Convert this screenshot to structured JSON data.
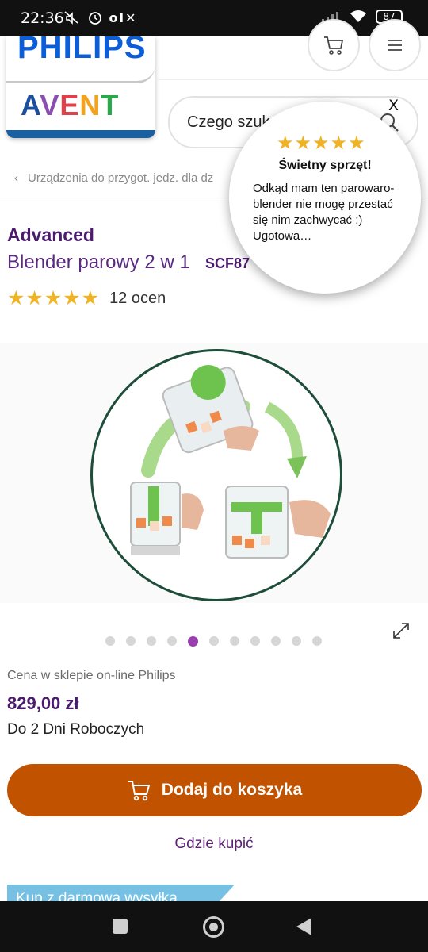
{
  "status_bar": {
    "time": "22:36",
    "icons": "✕⏰",
    "battery": "87"
  },
  "brand": {
    "philips": "PHILIPS",
    "avent": "AVENT",
    "avent_colors": [
      "#1b4f9c",
      "#8a4fb0",
      "#e0404a",
      "#f2a21b",
      "#2aa84a",
      "#1b4f9c"
    ]
  },
  "header": {
    "cart_icon": "cart-icon",
    "menu_icon": "menu-icon",
    "search_placeholder": "Czego szuk"
  },
  "breadcrumb": {
    "label": "Urządzenia do przygot. jedz. dla dz"
  },
  "product": {
    "brand_line": "Advanced",
    "title": "Blender parowy 2 w 1",
    "model": "SCF87",
    "rating_stars": "★★★★★",
    "rating": 5,
    "reviews": "12 ocen"
  },
  "carousel": {
    "dots": 11,
    "active_index": 4
  },
  "pricing": {
    "label": "Cena w sklepie on-line Philips",
    "price": "829,00  zł",
    "delivery": "Do 2 Dni Roboczych"
  },
  "actions": {
    "add_to_cart": "Dodaj do koszyka",
    "where_to_buy": "Gdzie kupić"
  },
  "promo": {
    "text": "Kup z darmową wysyłką"
  },
  "review_popup": {
    "stars": "★★★★★",
    "title": "Świetny sprzęt!",
    "body": "Odkąd mam ten parowaro-blender nie mogę przestać się nim zachwycać ;) Ugotowa…",
    "close": "X"
  },
  "colors": {
    "accent_purple": "#4b1b6e",
    "cart_orange": "#c15300",
    "star_gold": "#f0b323",
    "active_dot": "#9b3fb0"
  }
}
